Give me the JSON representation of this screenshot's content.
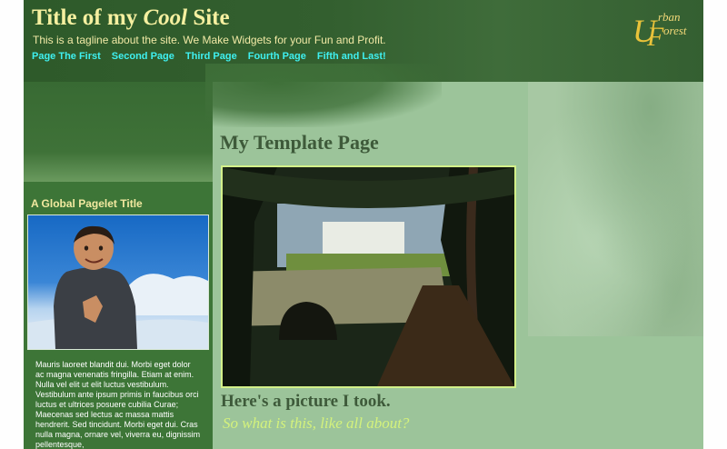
{
  "header": {
    "title_prefix": "Title of my ",
    "title_emphasis": "Cool",
    "title_suffix": " Site",
    "tagline": "This is a tagline about the site. We Make Widgets for your Fun and Profit.",
    "nav": [
      {
        "label": "Page The First"
      },
      {
        "label": "Second Page"
      },
      {
        "label": "Third Page"
      },
      {
        "label": "Fourth Page"
      },
      {
        "label": "Fifth and Last!"
      }
    ],
    "logo": {
      "text": "Urban Forest"
    }
  },
  "sidebar": {
    "pagelet_title": "A Global Pagelet Title",
    "body_text": "Mauris laoreet blandit dui. Morbi eget dolor ac magna venenatis fringilla. Etiam at enim. Nulla vel elit ut elit luctus vestibulum. Vestibulum ante ipsum primis in faucibus orci luctus et ultrices posuere cubilia Curae; Maecenas sed lectus ac massa mattis hendrerit. Sed tincidunt. Morbi eget dui. Cras nulla magna, ornare vel, viverra eu, dignissim pellentesque,"
  },
  "main": {
    "title": "My Template Page",
    "caption": "Here's a picture I took.",
    "sub_caption": "So what is this, like all about?"
  },
  "colors": {
    "header_bg": "#335f2f",
    "content_bg": "#9cc49a",
    "sidebar_bg": "#3d7537",
    "title_text": "#f6f0a0",
    "nav_link": "#3ff0f0",
    "heading_text": "#3e5a3a",
    "accent_lime": "#d4f27c"
  }
}
